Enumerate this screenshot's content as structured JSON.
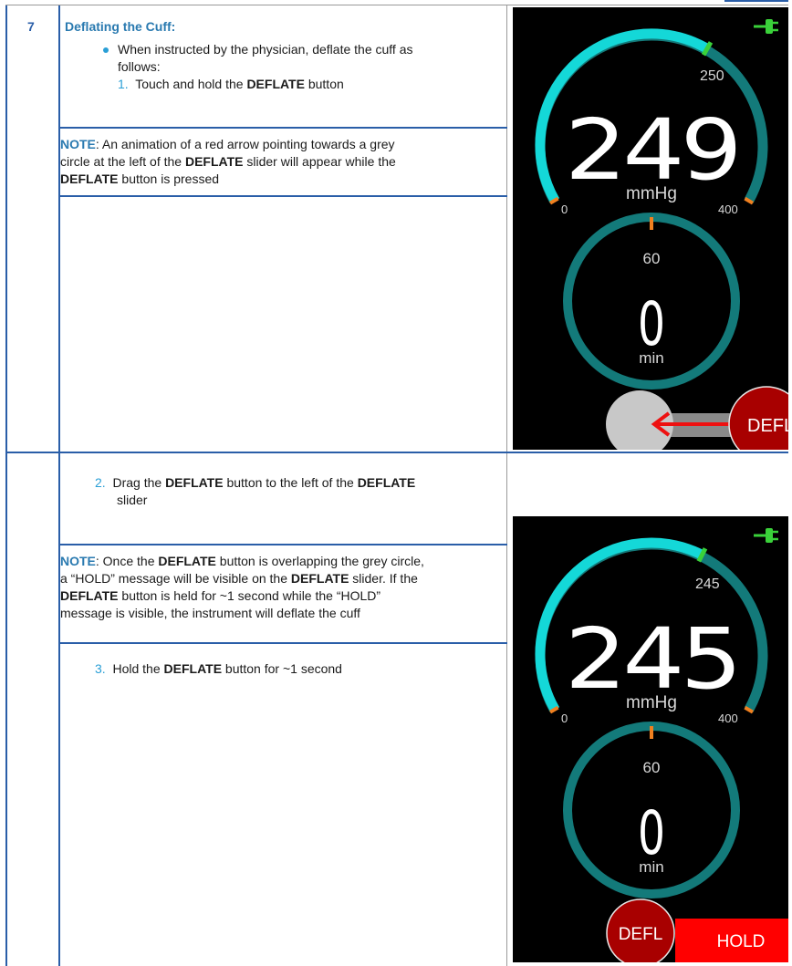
{
  "step": {
    "number": "7",
    "title": "Deflating the Cuff:"
  },
  "row1": {
    "bullet_line1": "When instructed by the physician, deflate the cuff as",
    "bullet_line2": "follows:",
    "item1_num": "1.",
    "item1_a": "Touch and hold the ",
    "item1_b": "DEFLATE",
    "item1_c": " button",
    "note_label": "NOTE",
    "note_l1": ": An animation of a red arrow pointing towards a grey",
    "note_l2a": "circle at the left of the ",
    "note_l2b": "DEFLATE",
    "note_l2c": " slider will appear while the",
    "note_l3a": "DEFLATE",
    "note_l3b": " button is pressed"
  },
  "row2": {
    "item2_num": "2.",
    "item2_a": "Drag the ",
    "item2_b": "DEFLATE",
    "item2_c": " button to the left of the ",
    "item2_d": "DEFLATE",
    "item2_e": "slider",
    "note_label": "NOTE",
    "note_l1": ": Once the ",
    "note_l1b": "DEFLATE",
    "note_l1c": " button is overlapping the grey circle,",
    "note_l2a": "a “HOLD” message will be visible on the ",
    "note_l2b": "DEFLATE",
    "note_l2c": " slider. If the",
    "note_l3a": "DEFLATE",
    "note_l3b": " button is held for ~1 second while the “HOLD”",
    "note_l4": "message is visible, the instrument will deflate the cuff",
    "item3_num": "3.",
    "item3_a": "Hold the ",
    "item3_b": "DEFLATE",
    "item3_c": " button for ~1 second"
  },
  "screen1": {
    "pressure": "249",
    "unit": "mmHg",
    "marker": "250",
    "scale_min": "0",
    "scale_max": "400",
    "timer_top": "60",
    "timer_value": "0",
    "timer_unit": "min",
    "button": "DEFL",
    "pressure_fraction": 0.6225,
    "marker_fraction": 0.625
  },
  "screen2": {
    "pressure": "245",
    "unit": "mmHg",
    "marker": "245",
    "scale_min": "0",
    "scale_max": "400",
    "timer_top": "60",
    "timer_value": "0",
    "timer_unit": "min",
    "button": "DEFL",
    "hold": "HOLD",
    "pressure_fraction": 0.6125,
    "marker_fraction": 0.6125
  },
  "colors": {
    "accent_blue": "#2a5ea8",
    "teal_track": "#137a7a",
    "cyan_arc": "#14d8d8",
    "orange_tick": "#f08020",
    "green_marker": "#3ad13a",
    "defl_red": "#a80000",
    "hold_red": "#ff0000"
  }
}
